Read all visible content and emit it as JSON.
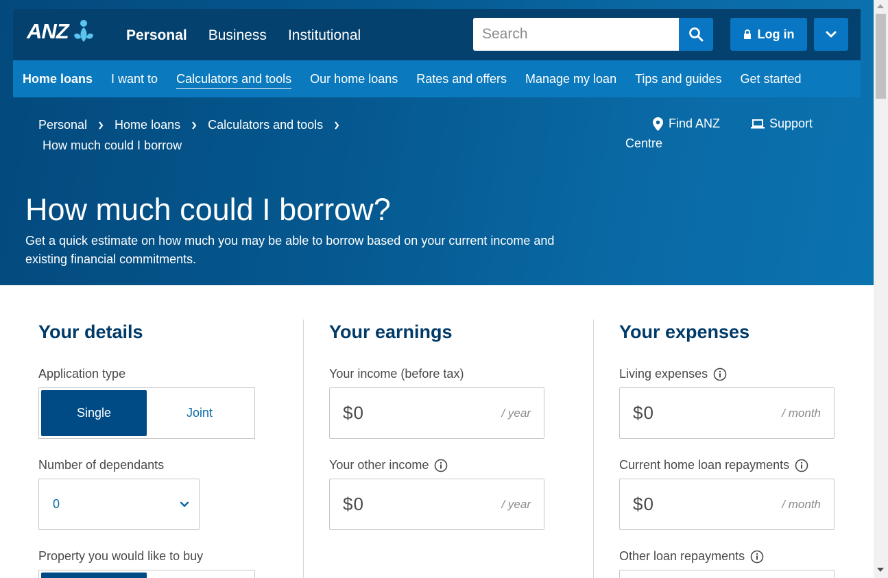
{
  "brand": {
    "logo_text": "ANZ"
  },
  "topnav": {
    "items": [
      "Personal",
      "Business",
      "Institutional"
    ]
  },
  "search": {
    "placeholder": "Search"
  },
  "login": {
    "label": "Log in"
  },
  "subnav": {
    "items": [
      "Home loans",
      "I want to",
      "Calculators and tools",
      "Our home loans",
      "Rates and offers",
      "Manage my loan",
      "Tips and guides",
      "Get started"
    ]
  },
  "breadcrumb": {
    "items": [
      "Personal",
      "Home loans",
      "Calculators and tools"
    ],
    "current": "How much could I borrow"
  },
  "utility": {
    "find_label": "Find ANZ",
    "find_label_cont": "Centre",
    "support_label": "Support"
  },
  "hero": {
    "title": "How much could I borrow?",
    "subtitle": "Get a quick estimate on how much you may be able to borrow based on your current income and existing financial commitments."
  },
  "details": {
    "heading": "Your details",
    "application_type_label": "Application type",
    "application_type_options": [
      "Single",
      "Joint"
    ],
    "application_type_selected": "Single",
    "dependants_label": "Number of dependants",
    "dependants_value": "0",
    "property_label": "Property you would like to buy"
  },
  "earnings": {
    "heading": "Your earnings",
    "income_label": "Your income (before tax)",
    "income_value": "$0",
    "income_unit": "/ year",
    "other_income_label": "Your other income",
    "other_income_value": "$0",
    "other_income_unit": "/ year"
  },
  "expenses": {
    "heading": "Your expenses",
    "living_label": "Living expenses",
    "living_value": "$0",
    "living_unit": "/ month",
    "home_loan_label": "Current home loan repayments",
    "home_loan_value": "$0",
    "home_loan_unit": "/ month",
    "other_loan_label": "Other loan repayments"
  },
  "colors": {
    "hero_dark": "#05416e",
    "accent": "#0876c2",
    "selected": "#004b85",
    "heading": "#003a68"
  }
}
